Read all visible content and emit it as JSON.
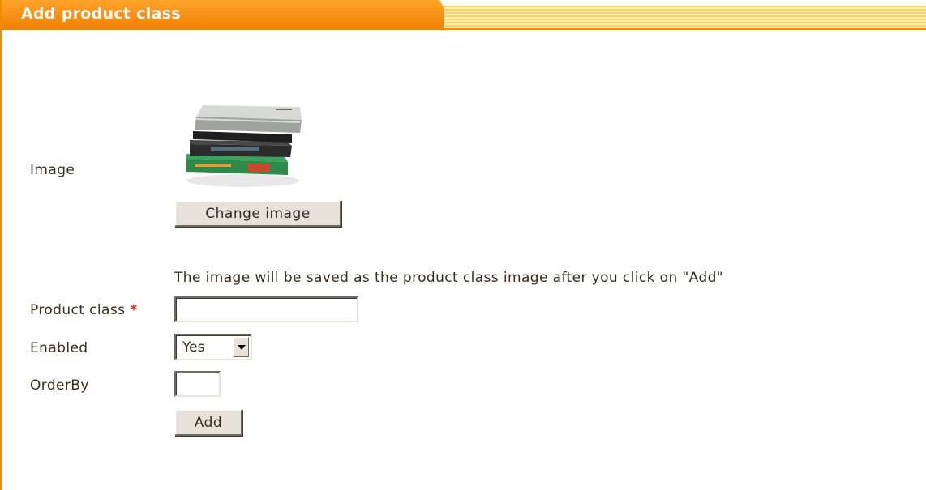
{
  "header": {
    "title": "Add product class"
  },
  "form": {
    "image_label": "Image",
    "change_image_label": "Change image",
    "note": "The image will be saved as the product class image after you click on \"Add\"",
    "product_class_label": "Product class",
    "required_mark": "*",
    "product_class_value": "",
    "enabled_label": "Enabled",
    "enabled_value": "Yes",
    "orderby_label": "OrderBy",
    "orderby_value": "",
    "add_label": "Add"
  },
  "colors": {
    "accent": "#f58a00",
    "required": "#d62c1a",
    "text": "#3a2b1c"
  },
  "icons": {
    "product_image": "book-stack-image",
    "dropdown": "chevron-down-icon"
  }
}
